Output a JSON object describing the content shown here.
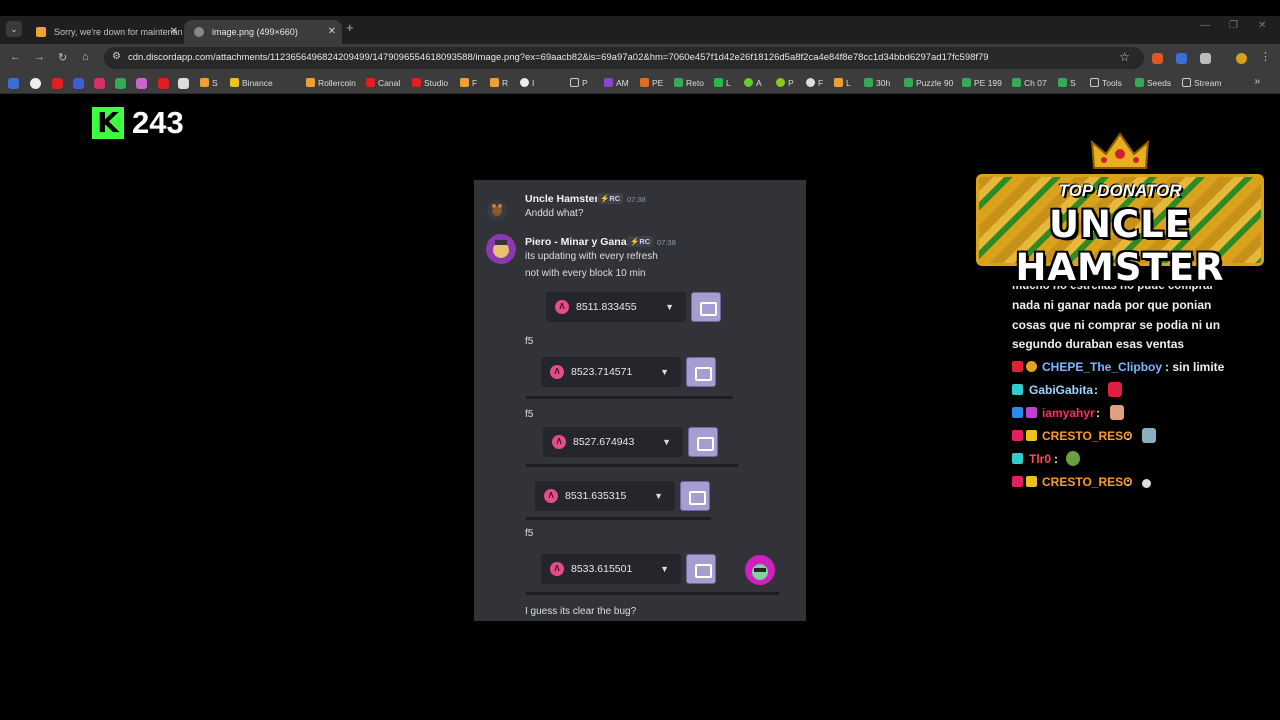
{
  "browser": {
    "tabs": [
      {
        "title": "Sorry, we're down for maintenan",
        "active": false
      },
      {
        "title": "image.png (499×660)",
        "active": true
      }
    ],
    "url": "cdn.discordapp.com/attachments/1123656496824209499/1479096554618093588/image.png?ex=69aacb82&is=69a97a02&hm=7060e457f1d42e26f18126d5a8f2ca4e84f8e78cc1d34bbd6297ad17fc598f79",
    "bookmarks": [
      "S",
      "Binance",
      "Rollercoin",
      "Canal",
      "Studio",
      "F",
      "R",
      "I",
      "P",
      "AM",
      "PE",
      "Reto",
      "L",
      "A",
      "P",
      "F",
      "L",
      "30h",
      "Puzzle 90",
      "PE 199",
      "Ch 07",
      "S",
      "Tools",
      "Seeds",
      "Stream"
    ]
  },
  "overlay": {
    "kick_logo": "K",
    "viewer_count": "243"
  },
  "discord": {
    "messages": [
      {
        "user": "Uncle Hamster",
        "tag": "⚡RC",
        "time": "07:38",
        "lines": [
          "Anddd what?"
        ]
      },
      {
        "user": "Piero - Minar y Ganar",
        "tag": "⚡RC",
        "time": "07:38",
        "lines": [
          "its updating with every refresh",
          "not with every block 10 min"
        ]
      }
    ],
    "balances": [
      "8511.833455",
      "8523.714571",
      "8527.674943",
      "8531.635315",
      "8533.615501"
    ],
    "f5_label": "f5",
    "final_message": "I guess its clear the bug?"
  },
  "donor": {
    "line1": "TOP DONATOR",
    "line2": "UNCLE HAMSTER"
  },
  "chat": {
    "cut_line": "mucho no estrellas no pude comprar",
    "text_lines": [
      "nada ni ganar nada por que ponian",
      "cosas que ni comprar se podia ni un",
      "segundo duraban esas ventas"
    ],
    "messages": [
      {
        "nick": "CHEPE_The_Clipboy",
        "color": "#7fb8ff",
        "after": ": sin limite"
      },
      {
        "nick": "GabiGabita",
        "color": "#9ad7ff",
        "after": " :"
      },
      {
        "nick": "iamyahyr",
        "color": "#ff2d5a",
        "after": " :"
      },
      {
        "nick": "CRESTO_RESO",
        "color": "#ff9a2a",
        "after": " :"
      },
      {
        "nick": "Tlr0",
        "color": "#ff4a4a",
        "after": " :"
      },
      {
        "nick": "CRESTO_RESO",
        "color": "#ff9a2a",
        "after": " :"
      }
    ]
  }
}
